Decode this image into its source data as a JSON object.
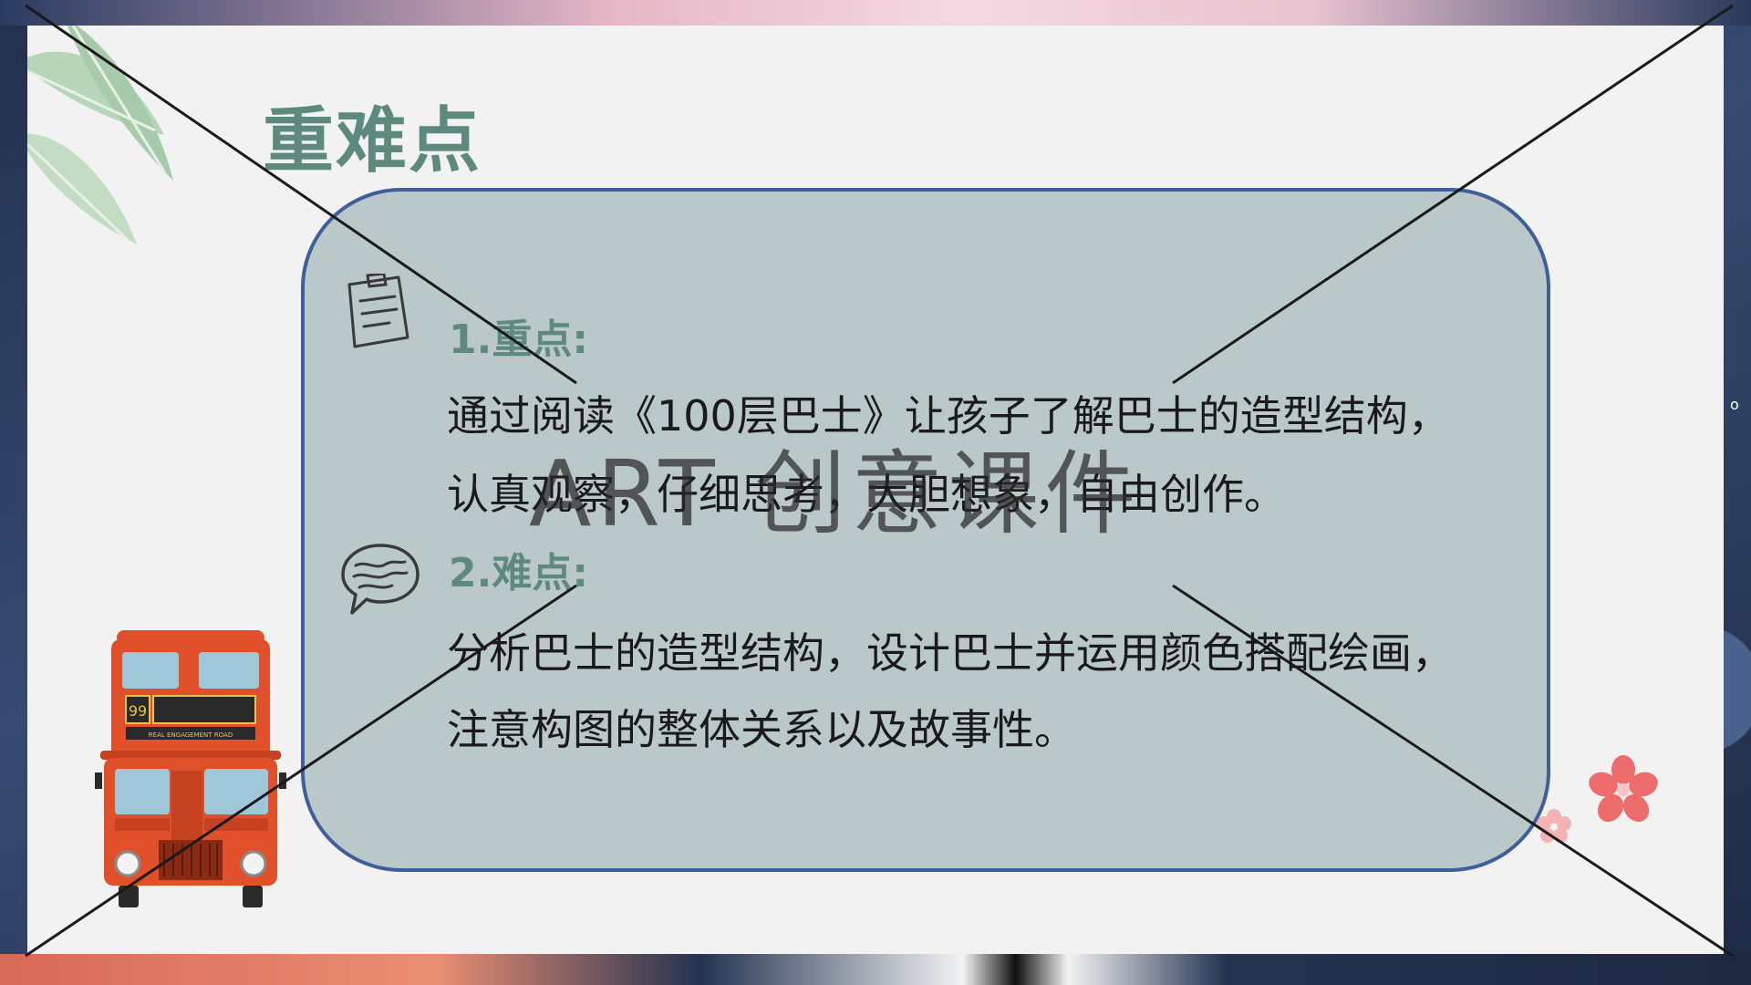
{
  "slide": {
    "title": "重难点",
    "watermark": "ART 创意课件",
    "sections": [
      {
        "heading": "1.重点:",
        "icon": "notepad-icon",
        "lines": [
          "通过阅读《100层巴士》让孩子了解巴士的造型结构，",
          "认真观察，仔细思考，大胆想象，自由创作。"
        ]
      },
      {
        "heading": "2.难点:",
        "icon": "speech-bubble-icon",
        "lines": [
          "分析巴士的造型结构，设计巴士并运用颜色搭配绘画，",
          "注意构图的整体关系以及故事性。"
        ]
      }
    ],
    "bus": {
      "route_number": "99",
      "road_sign": "REAL ENGAGEMENT ROAD",
      "icon": "double-decker-bus-icon"
    },
    "edge_mark": "o"
  },
  "colors": {
    "title": "#5d8a7c",
    "panel_fill": "#bbc8c9",
    "panel_border": "#3f5f9c",
    "bus_red": "#e0502a",
    "cross_line": "#1a1a1a"
  }
}
